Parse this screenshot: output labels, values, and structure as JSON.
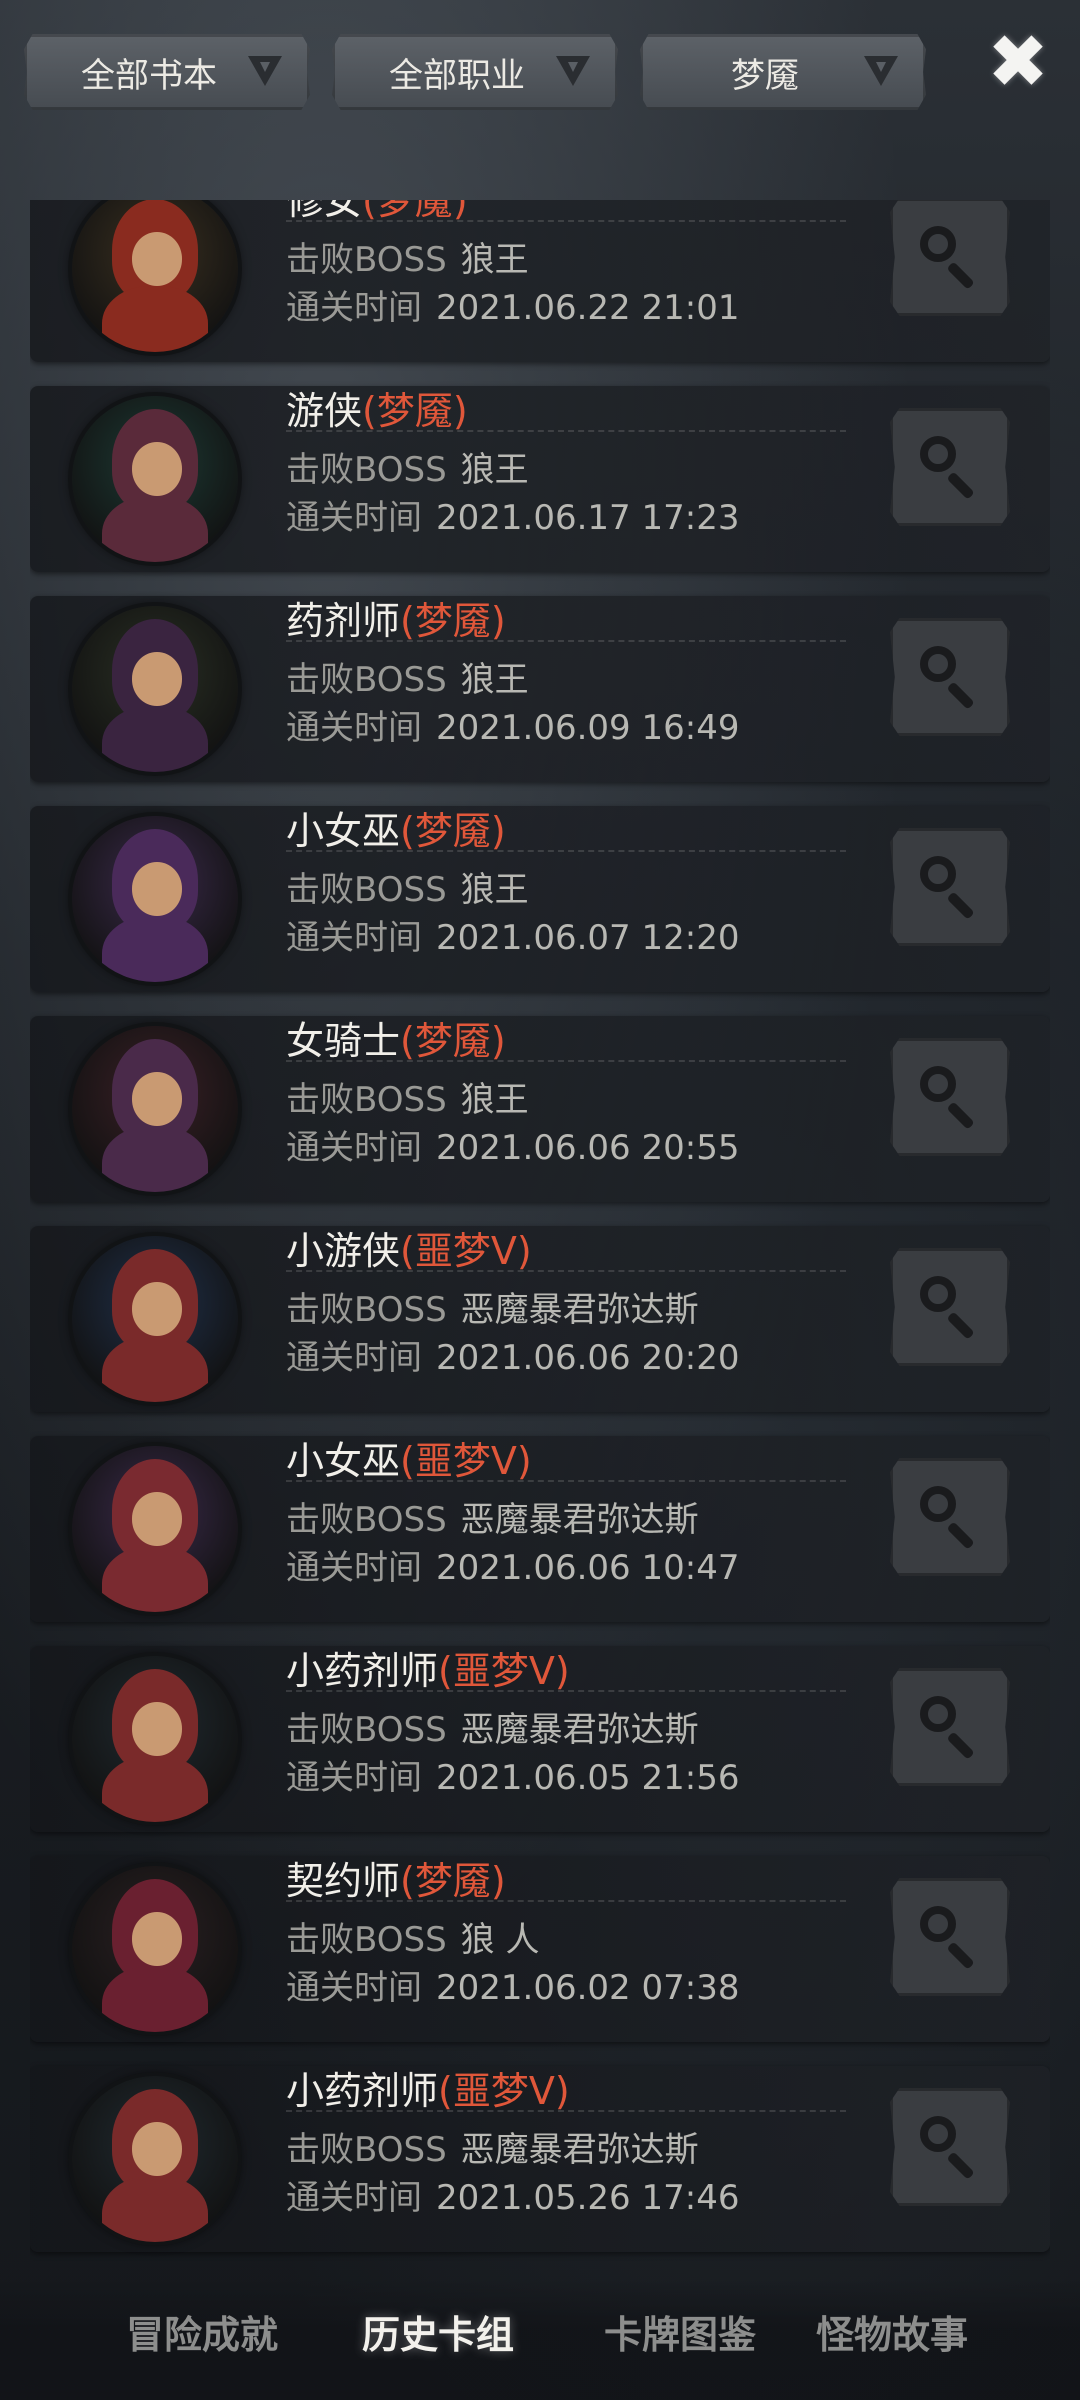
{
  "filters": [
    {
      "label": "全部书本",
      "icon": "dropdown-triangle-icon"
    },
    {
      "label": "全部职业",
      "icon": "dropdown-triangle-icon"
    },
    {
      "label": "梦魇",
      "icon": "dropdown-triangle-icon"
    }
  ],
  "close": {
    "icon": "close-icon",
    "glyph": "✖"
  },
  "labels": {
    "boss": "击败BOSS",
    "time": "通关时间"
  },
  "records": [
    {
      "name": "修女",
      "difficulty": "(梦魇)",
      "boss": "狼王",
      "time": "2021.06.22 21:01",
      "hood": "#8a2b1f",
      "bg": "#3a3020"
    },
    {
      "name": "游侠",
      "difficulty": "(梦魇)",
      "boss": "狼王",
      "time": "2021.06.17 17:23",
      "hood": "#5a2a3a",
      "bg": "#1d3a34"
    },
    {
      "name": "药剂师",
      "difficulty": "(梦魇)",
      "boss": "狼王",
      "time": "2021.06.09 16:49",
      "hood": "#3a2440",
      "bg": "#2a3024"
    },
    {
      "name": "小女巫",
      "difficulty": "(梦魇)",
      "boss": "狼王",
      "time": "2021.06.07 12:20",
      "hood": "#4a2a5a",
      "bg": "#3a2a4a"
    },
    {
      "name": "女骑士",
      "difficulty": "(梦魇)",
      "boss": "狼王",
      "time": "2021.06.06 20:55",
      "hood": "#4a2a4a",
      "bg": "#3a2026"
    },
    {
      "name": "小游侠",
      "difficulty": "(噩梦V)",
      "boss": "恶魔暴君弥达斯",
      "time": "2021.06.06 20:20",
      "hood": "#7a2a2a",
      "bg": "#20304a"
    },
    {
      "name": "小女巫",
      "difficulty": "(噩梦V)",
      "boss": "恶魔暴君弥达斯",
      "time": "2021.06.06 10:47",
      "hood": "#7a2a30",
      "bg": "#3a2a4a"
    },
    {
      "name": "小药剂师",
      "difficulty": "(噩梦V)",
      "boss": "恶魔暴君弥达斯",
      "time": "2021.06.05 21:56",
      "hood": "#7a2a2a",
      "bg": "#202a30"
    },
    {
      "name": "契约师",
      "difficulty": "(梦魇)",
      "boss": "狼 人",
      "time": "2021.06.02 07:38",
      "hood": "#6a2030",
      "bg": "#2a2022"
    },
    {
      "name": "小药剂师",
      "difficulty": "(噩梦V)",
      "boss": "恶魔暴君弥达斯",
      "time": "2021.05.26 17:46",
      "hood": "#7a2a2a",
      "bg": "#202a30"
    }
  ],
  "tabs": [
    {
      "label": "冒险成就",
      "active": false
    },
    {
      "label": "历史卡组",
      "active": true
    },
    {
      "label": "卡牌图鉴",
      "active": false
    },
    {
      "label": "怪物故事",
      "active": false
    }
  ]
}
